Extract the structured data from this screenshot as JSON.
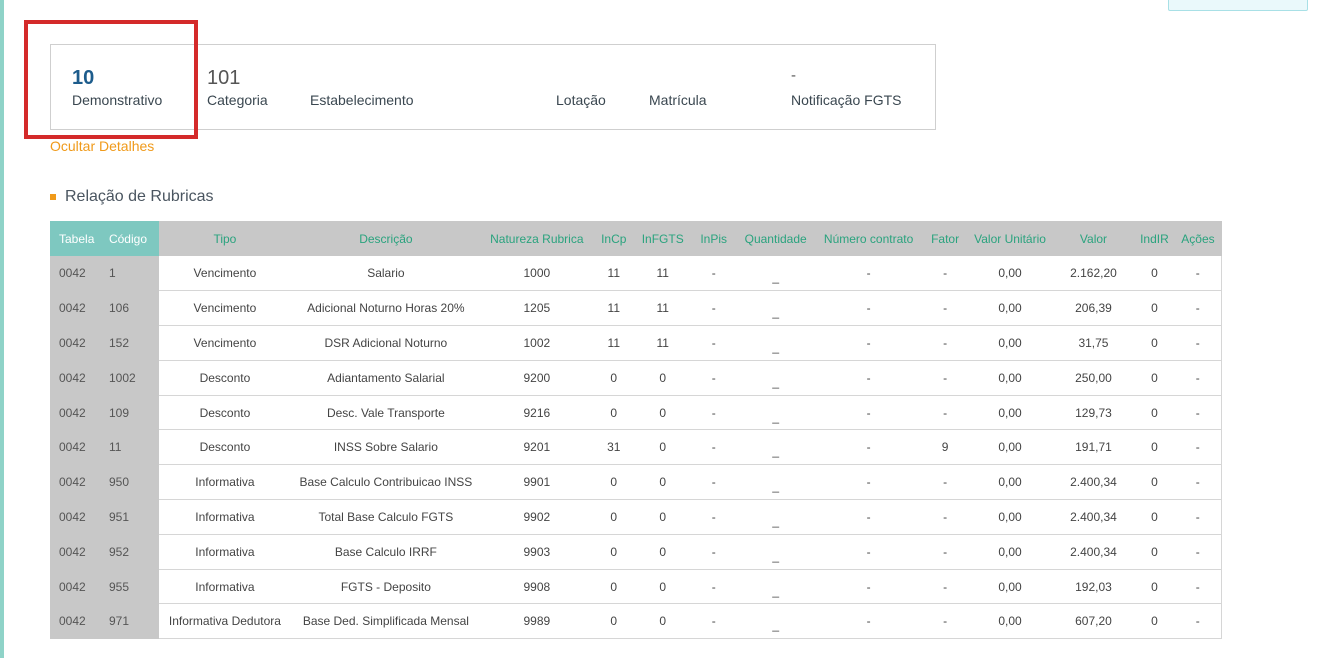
{
  "summary": {
    "demonstrativo": {
      "value": "10",
      "label": "Demonstrativo"
    },
    "categoria": {
      "value": "101",
      "label": "Categoria"
    },
    "estabelecimento": {
      "value": "",
      "label": "Estabelecimento"
    },
    "lotacao": {
      "value": "",
      "label": "Lotação"
    },
    "matricula": {
      "value": "",
      "label": "Matrícula"
    },
    "notificacao_fgts": {
      "value": "-",
      "label": "Notificação FGTS"
    }
  },
  "hide_details_label": "Ocultar Detalhes",
  "section_title": "Relação de Rubricas",
  "colors": {
    "accent": "#1d5c8c",
    "orange": "#f09a1a",
    "header_green": "#2aa37e",
    "header_teal": "#7ec8c0",
    "highlight": "#d42a2a"
  },
  "table": {
    "headers": [
      "Tabela",
      "Código",
      "Tipo",
      "Descrição",
      "Natureza Rubrica",
      "InCp",
      "InFGTS",
      "InPis",
      "Quantidade",
      "Número contrato",
      "Fator",
      "Valor Unitário",
      "Valor",
      "IndIR",
      "Ações"
    ],
    "rows": [
      [
        "0042",
        "1",
        "Vencimento",
        "Salario",
        "1000",
        "11",
        "11",
        "-",
        "_",
        "-",
        "-",
        "0,00",
        "2.162,20",
        "0",
        "-"
      ],
      [
        "0042",
        "106",
        "Vencimento",
        "Adicional Noturno Horas 20%",
        "1205",
        "11",
        "11",
        "-",
        "_",
        "-",
        "-",
        "0,00",
        "206,39",
        "0",
        "-"
      ],
      [
        "0042",
        "152",
        "Vencimento",
        "DSR Adicional Noturno",
        "1002",
        "11",
        "11",
        "-",
        "_",
        "-",
        "-",
        "0,00",
        "31,75",
        "0",
        "-"
      ],
      [
        "0042",
        "1002",
        "Desconto",
        "Adiantamento Salarial",
        "9200",
        "0",
        "0",
        "-",
        "_",
        "-",
        "-",
        "0,00",
        "250,00",
        "0",
        "-"
      ],
      [
        "0042",
        "109",
        "Desconto",
        "Desc. Vale Transporte",
        "9216",
        "0",
        "0",
        "-",
        "_",
        "-",
        "-",
        "0,00",
        "129,73",
        "0",
        "-"
      ],
      [
        "0042",
        "11",
        "Desconto",
        "INSS Sobre Salario",
        "9201",
        "31",
        "0",
        "-",
        "_",
        "-",
        "9",
        "0,00",
        "191,71",
        "0",
        "-"
      ],
      [
        "0042",
        "950",
        "Informativa",
        "Base Calculo Contribuicao INSS",
        "9901",
        "0",
        "0",
        "-",
        "_",
        "-",
        "-",
        "0,00",
        "2.400,34",
        "0",
        "-"
      ],
      [
        "0042",
        "951",
        "Informativa",
        "Total Base Calculo FGTS",
        "9902",
        "0",
        "0",
        "-",
        "_",
        "-",
        "-",
        "0,00",
        "2.400,34",
        "0",
        "-"
      ],
      [
        "0042",
        "952",
        "Informativa",
        "Base Calculo IRRF",
        "9903",
        "0",
        "0",
        "-",
        "_",
        "-",
        "-",
        "0,00",
        "2.400,34",
        "0",
        "-"
      ],
      [
        "0042",
        "955",
        "Informativa",
        "FGTS - Deposito",
        "9908",
        "0",
        "0",
        "-",
        "_",
        "-",
        "-",
        "0,00",
        "192,03",
        "0",
        "-"
      ],
      [
        "0042",
        "971",
        "Informativa Dedutora",
        "Base Ded. Simplificada Mensal",
        "9989",
        "0",
        "0",
        "-",
        "_",
        "-",
        "-",
        "0,00",
        "607,20",
        "0",
        "-"
      ]
    ]
  }
}
